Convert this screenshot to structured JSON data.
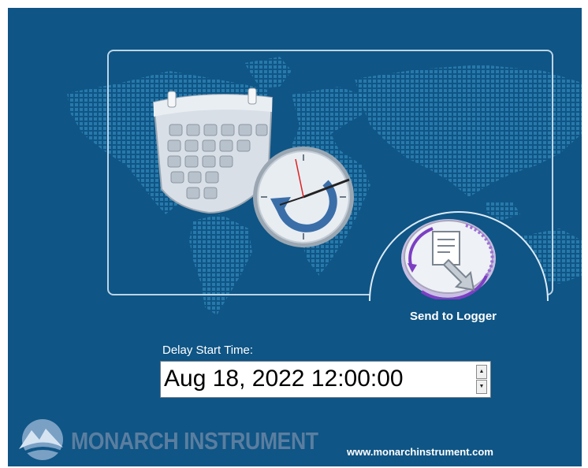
{
  "send_button": {
    "label": "Send to Logger"
  },
  "delay_start": {
    "label": "Delay Start Time:",
    "value": "Aug 18, 2022 12:00:00",
    "spin_up": "▲",
    "spin_down": "▼"
  },
  "footer": {
    "brand": "MONARCH INSTRUMENT",
    "url": "www.monarchinstrument.com"
  },
  "icons": {
    "calendar": "calendar-icon",
    "clock": "clock-icon",
    "send_document": "document-send-icon",
    "logo": "monarch-logo-icon"
  },
  "colors": {
    "background": "#0f5585",
    "map_dots": "#2f86b8",
    "panel_border": "#dcebf8",
    "ring_purple": "#7c3fc4",
    "text": "#ffffff",
    "brand_text": "#5a7ea0"
  }
}
